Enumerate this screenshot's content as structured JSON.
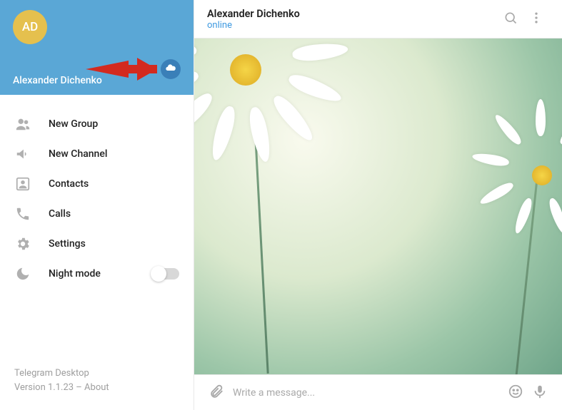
{
  "sidebar": {
    "avatar_initials": "AD",
    "profile_name": "Alexander Dichenko",
    "menu": [
      {
        "label": "New Group"
      },
      {
        "label": "New Channel"
      },
      {
        "label": "Contacts"
      },
      {
        "label": "Calls"
      },
      {
        "label": "Settings"
      },
      {
        "label": "Night mode"
      }
    ],
    "footer_title": "Telegram Desktop",
    "footer_version": "Version 1.1.23 – About"
  },
  "chat": {
    "title": "Alexander Dichenko",
    "status": "online",
    "input_placeholder": "Write a message..."
  },
  "colors": {
    "header_bg": "#5aa7d6",
    "avatar_bg": "#e5c04e",
    "accent_link": "#3f9ae0",
    "annotation_arrow": "#d32a1f"
  }
}
